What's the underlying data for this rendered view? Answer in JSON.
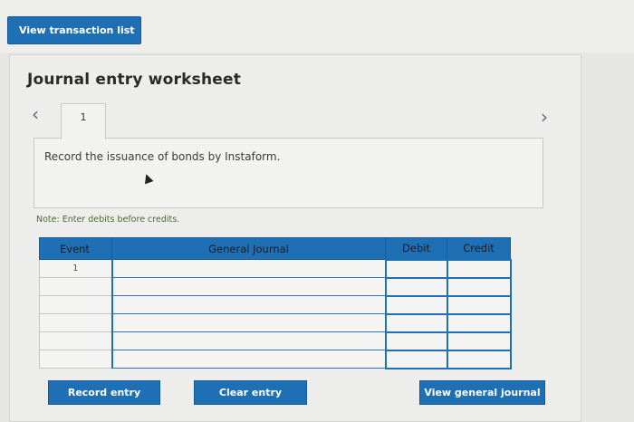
{
  "toolbar": {
    "view_transactions_label": "View transaction list"
  },
  "worksheet": {
    "title": "Journal entry worksheet",
    "tab_number": "1",
    "prev_icon": "chevron-left-icon",
    "next_icon": "chevron-right-icon",
    "instruction": "Record the issuance of bonds by Instaform.",
    "note": "Note: Enter debits before credits."
  },
  "journal_table": {
    "headers": {
      "event": "Event",
      "general_journal": "General Journal",
      "debit": "Debit",
      "credit": "Credit"
    },
    "rows": [
      {
        "event": "1",
        "account": "",
        "debit": "",
        "credit": ""
      },
      {
        "event": "",
        "account": "",
        "debit": "",
        "credit": ""
      },
      {
        "event": "",
        "account": "",
        "debit": "",
        "credit": ""
      },
      {
        "event": "",
        "account": "",
        "debit": "",
        "credit": ""
      },
      {
        "event": "",
        "account": "",
        "debit": "",
        "credit": ""
      },
      {
        "event": "",
        "account": "",
        "debit": "",
        "credit": ""
      }
    ]
  },
  "actions": {
    "record_label": "Record entry",
    "clear_label": "Clear entry",
    "view_gj_label": "View general journal"
  },
  "colors": {
    "primary": "#1f6fb5",
    "panel_bg": "#ededeb",
    "note": "#4a6a30"
  }
}
